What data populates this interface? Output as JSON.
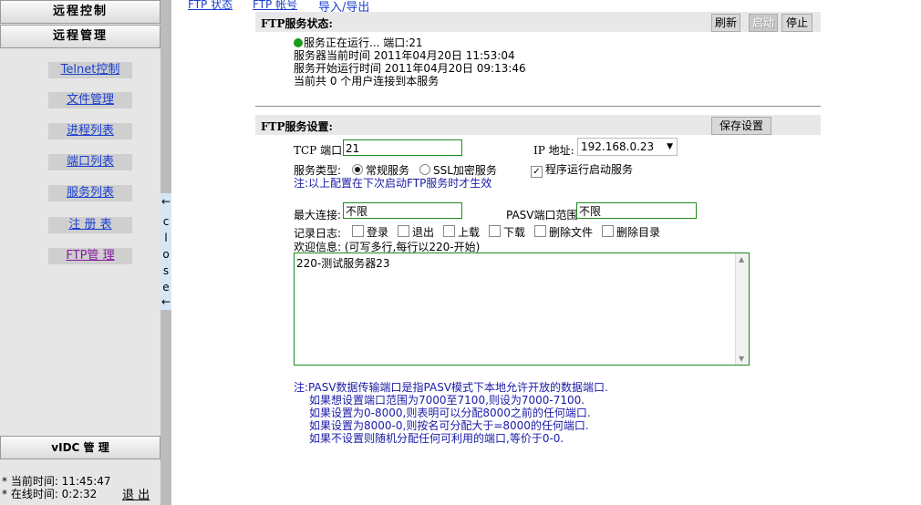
{
  "sidebar": {
    "header_remote_control": "远程控制",
    "header_remote_manage": "远程管理",
    "items": [
      {
        "label": "Telnet控制"
      },
      {
        "label": "文件管理"
      },
      {
        "label": "进程列表"
      },
      {
        "label": "端口列表"
      },
      {
        "label": "服务列表"
      },
      {
        "label": "注 册 表"
      },
      {
        "label": "FTP管 理"
      }
    ],
    "vidc_header": "vIDC 管 理",
    "current_time": "* 当前时间: 11:45:47",
    "online_time": "* 在线时间: 0:2:32",
    "logout": "退 出"
  },
  "collapse_bar": {
    "arrow_top": "←",
    "letters": [
      "c",
      "l",
      "o",
      "s",
      "e"
    ],
    "arrow_bottom": "←"
  },
  "top_tabs": [
    "FTP 状态",
    "FTP 帐号",
    "导入/导出"
  ],
  "status_section": {
    "title": "FTP服务状态:",
    "buttons": {
      "refresh": "刷新",
      "start": "启动",
      "stop": "停止"
    },
    "running": "服务正在运行...   端口:21",
    "current_time": "服务器当前时间   2011年04月20日 11:53:04",
    "start_time": "服务开始运行时间 2011年04月20日 09:13:46",
    "users": "当前共 0 个用户连接到本服务"
  },
  "settings_section": {
    "title": "FTP服务设置:",
    "save_button": "保存设置",
    "tcp_port_label": "TCP 端口:",
    "tcp_port_value": "21",
    "ip_label": "IP 地址:",
    "ip_value": "192.168.0.23",
    "service_type_label": "服务类型:",
    "service_normal": "常规服务",
    "service_ssl": "SSL加密服务",
    "autostart_label": "程序运行启动服务",
    "note": "注:以上配置在下次启动FTP服务时才生效",
    "max_conn_label": "最大连接:",
    "max_conn_value": "不限",
    "pasv_label": "PASV端口范围:",
    "pasv_value": "不限",
    "log_label": "记录日志:",
    "log_options": [
      "登录",
      "退出",
      "上载",
      "下载",
      "删除文件",
      "删除目录"
    ],
    "welcome_label": "欢迎信息: (可写多行,每行以220-开始)",
    "welcome_text": "220-测试服务器23",
    "pasv_notes": [
      "注:PASV数据传输端口是指PASV模式下本地允许开放的数据端口.",
      "如果想设置端口范围为7000至7100,则设为7000-7100.",
      "如果设置为0-8000,则表明可以分配8000之前的任何端口.",
      "如果设置为8000-0,则按名可分配大于=8000的任何端口.",
      "如果不设置则随机分配任何可利用的端口,等价于0-0."
    ]
  },
  "colors": {
    "sidebar_bg": "#e6e6e6",
    "link_blue": "#1a3fd0",
    "note_blue": "#1a1aa8",
    "input_border": "#1d8a1d",
    "status_green": "#1b9a1b"
  }
}
